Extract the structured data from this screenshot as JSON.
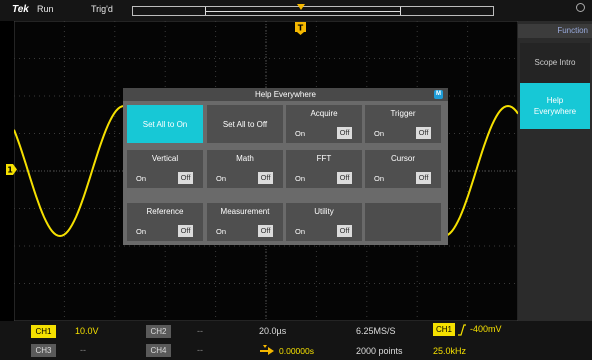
{
  "topbar": {
    "brand": "Tek",
    "run_status": "Run",
    "trigger_status": "Trig'd"
  },
  "right_panel": {
    "header": "Function",
    "items": [
      {
        "label": "Scope Intro",
        "selected": false
      },
      {
        "label": "Help Everywhere",
        "selected": true
      }
    ]
  },
  "dialog": {
    "title": "Help Everywhere",
    "close_icon": "M",
    "actions": [
      {
        "label": "Set All to On",
        "selected": true
      },
      {
        "label": "Set All to Off",
        "selected": false
      }
    ],
    "toggles": [
      {
        "label": "Acquire",
        "on": "On",
        "off": "Off"
      },
      {
        "label": "Trigger",
        "on": "On",
        "off": "Off"
      },
      {
        "label": "Vertical",
        "on": "On",
        "off": "Off"
      },
      {
        "label": "Math",
        "on": "On",
        "off": "Off"
      },
      {
        "label": "FFT",
        "on": "On",
        "off": "Off"
      },
      {
        "label": "Cursor",
        "on": "On",
        "off": "Off"
      },
      {
        "label": "Reference",
        "on": "On",
        "off": "Off"
      },
      {
        "label": "Measurement",
        "on": "On",
        "off": "Off"
      },
      {
        "label": "Utility",
        "on": "On",
        "off": "Off"
      }
    ]
  },
  "bottombar": {
    "ch1_label": "CH1",
    "ch1_scale": "10.0V",
    "ch2_label": "CH2",
    "ch2_value": "--",
    "ch3_label": "CH3",
    "ch3_value": "--",
    "ch4_label": "CH4",
    "ch4_value": "--",
    "horizontal_scale": "20.0µs",
    "trigger_position": "0.00000s",
    "sample_rate": "6.25MS/S",
    "record_length": "2000 points",
    "trigger_source": "CH1",
    "trigger_level": "-400mV",
    "frequency": "25.0kHz"
  },
  "colors": {
    "ch1": "#f5e000",
    "accent": "#17c8d6",
    "trigger_marker": "#f5b800"
  },
  "markers": {
    "ch1_ground": "1",
    "trigger": "T"
  }
}
